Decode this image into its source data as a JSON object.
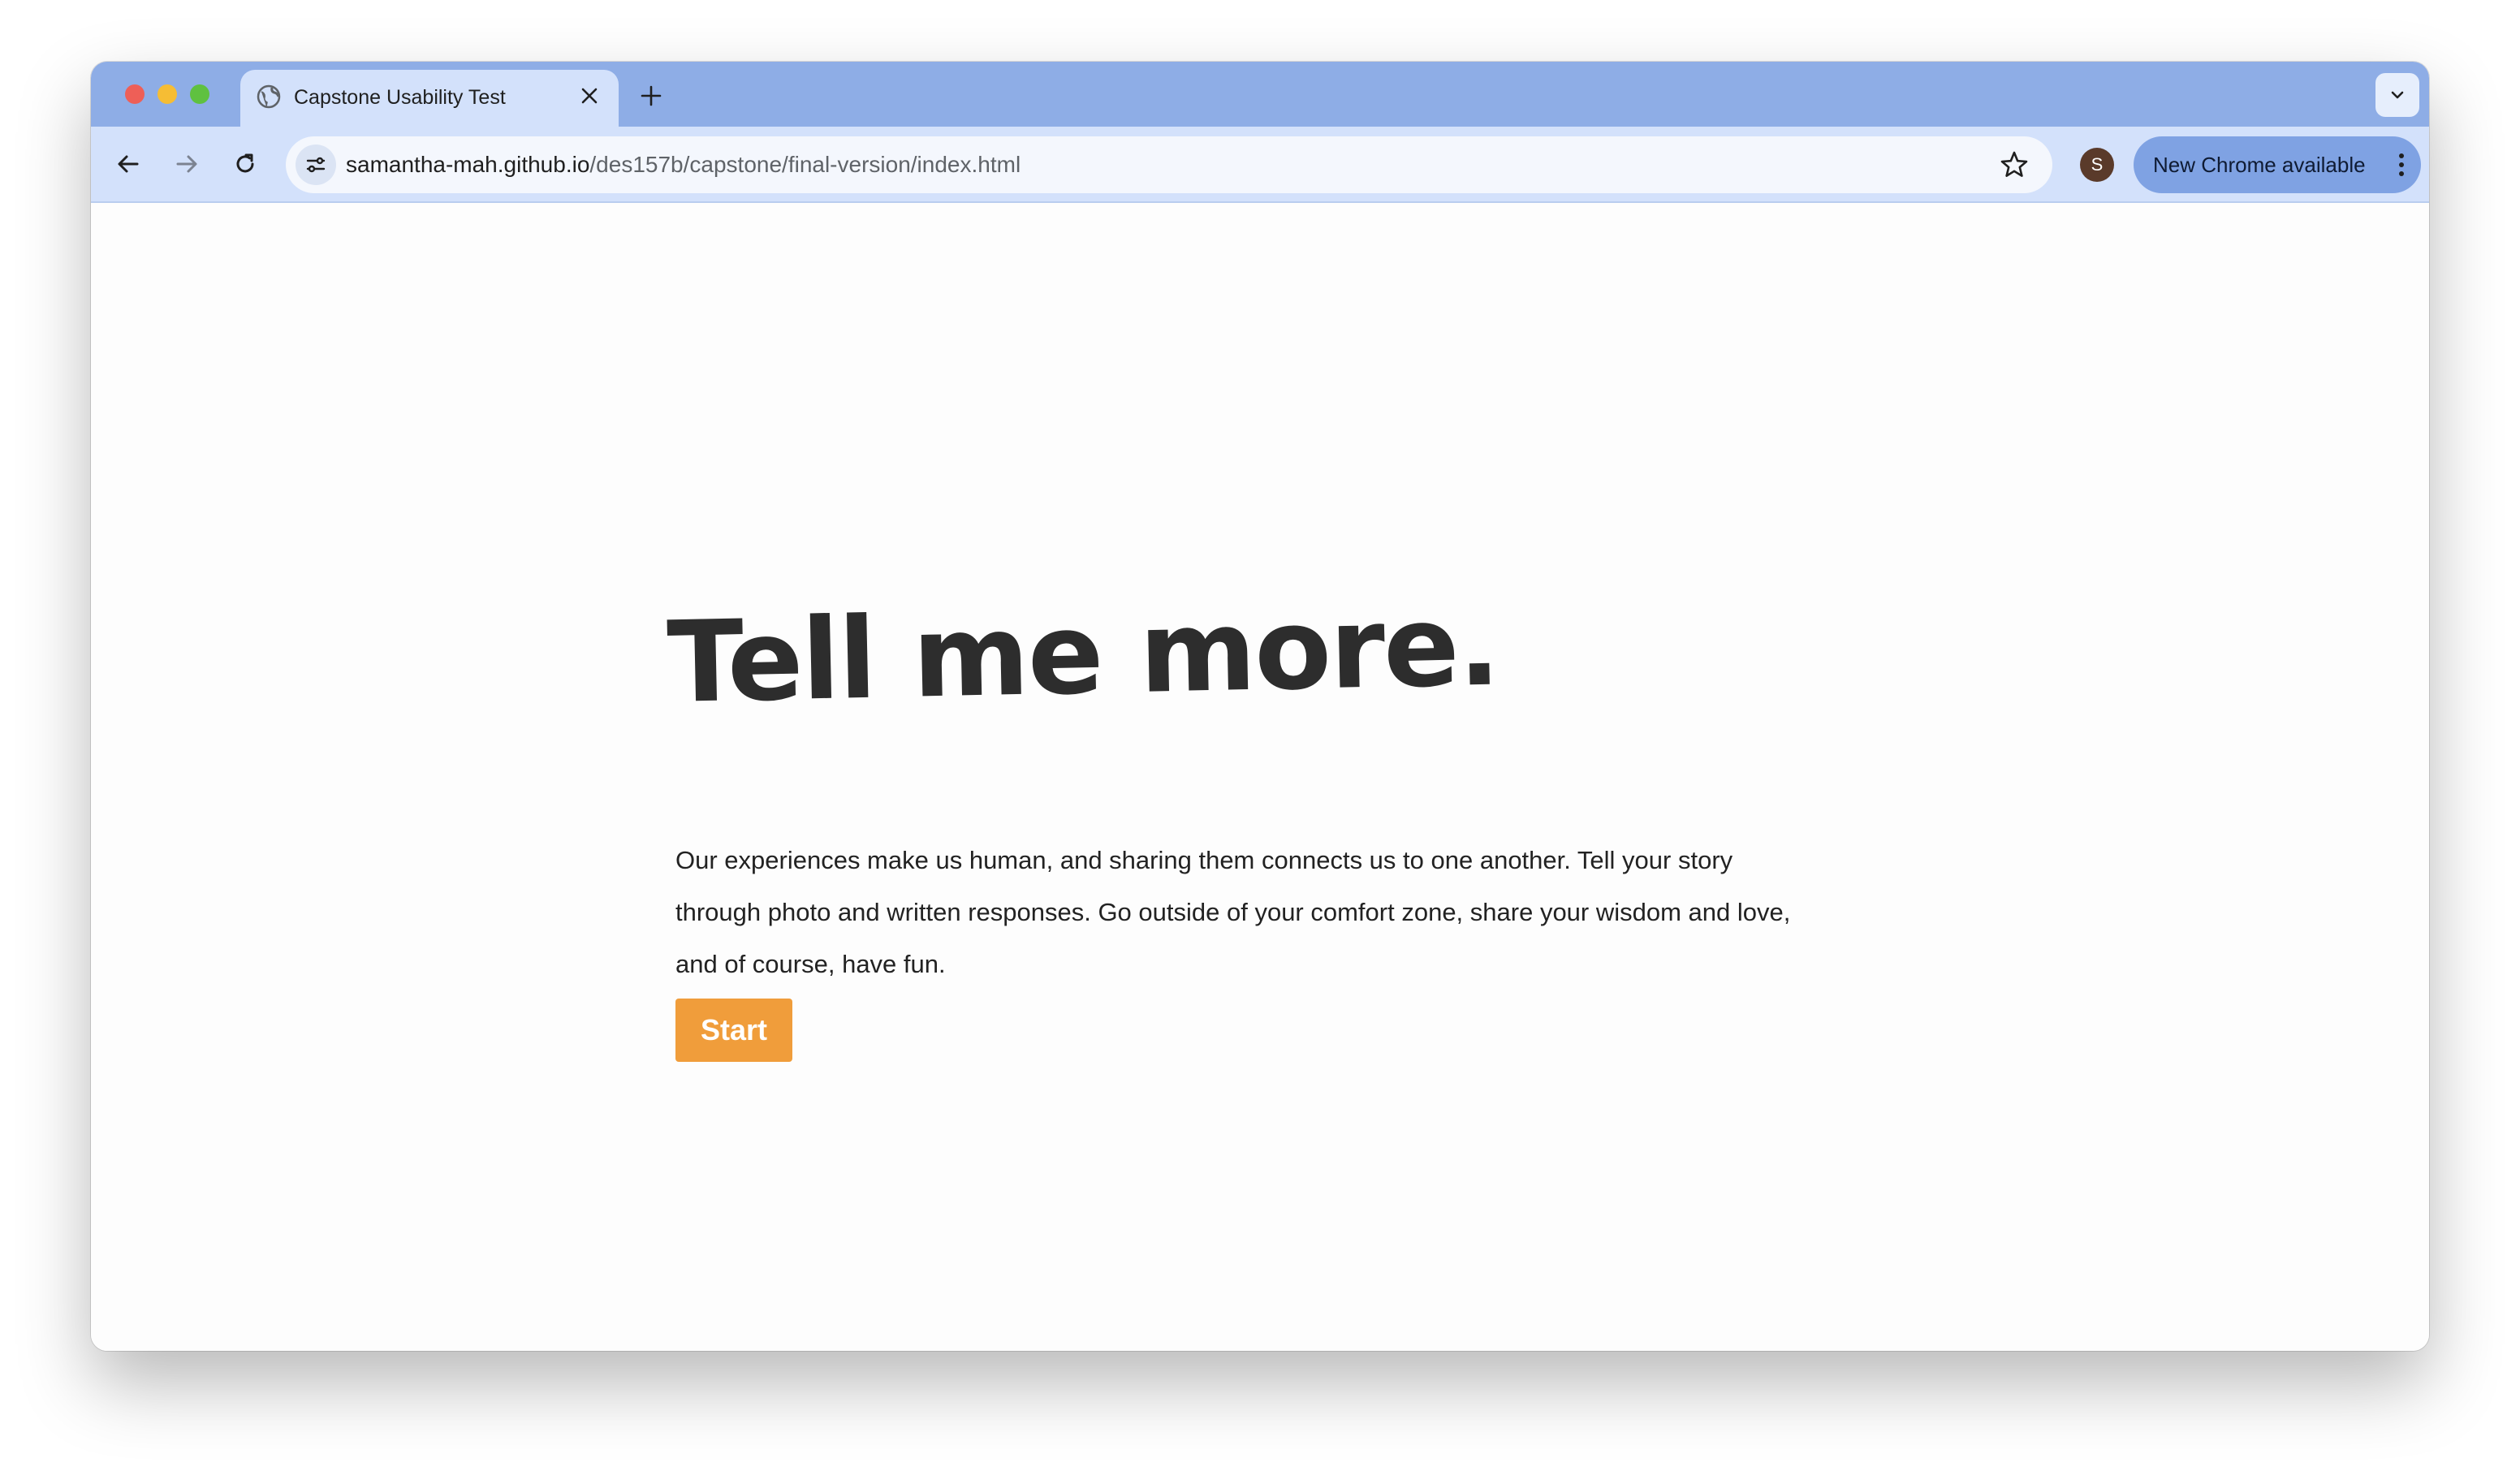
{
  "browser": {
    "tab": {
      "title": "Capstone Usability Test",
      "close_glyph": "✕",
      "favicon": "globe-icon"
    },
    "new_tab_glyph": "+",
    "tab_search_icon": "chevron-down-icon",
    "nav": {
      "back_icon": "arrow-left-icon",
      "forward_icon": "arrow-right-icon",
      "reload_icon": "reload-icon"
    },
    "omnibox": {
      "site_info_icon": "tune-icon",
      "url_host": "samantha-mah.github.io",
      "url_path": "/des157b/capstone/final-version/index.html",
      "bookmark_icon": "star-outline-icon"
    },
    "profile_initial": "S",
    "update_chip": {
      "label": "New Chrome available",
      "menu_icon": "kebab-menu-icon"
    },
    "colors": {
      "tabstrip": "#8eade6",
      "toolbar": "#d3e1fb",
      "update_chip": "#7fa2e3",
      "avatar": "#5a3a2a"
    }
  },
  "page": {
    "title": "Tell me more.",
    "intro_line_1": "Our experiences make us human, and sharing them connects us to one another. Tell your story",
    "intro_line_2": "through photo and written responses. Go outside of your comfort zone, share your wisdom and love,",
    "intro_line_3": "and of course, have fun.",
    "start_label": "Start",
    "colors": {
      "start_button": "#f09d3b",
      "text": "#222222",
      "title": "#2d2d2d",
      "background": "#fdfdfd"
    }
  }
}
